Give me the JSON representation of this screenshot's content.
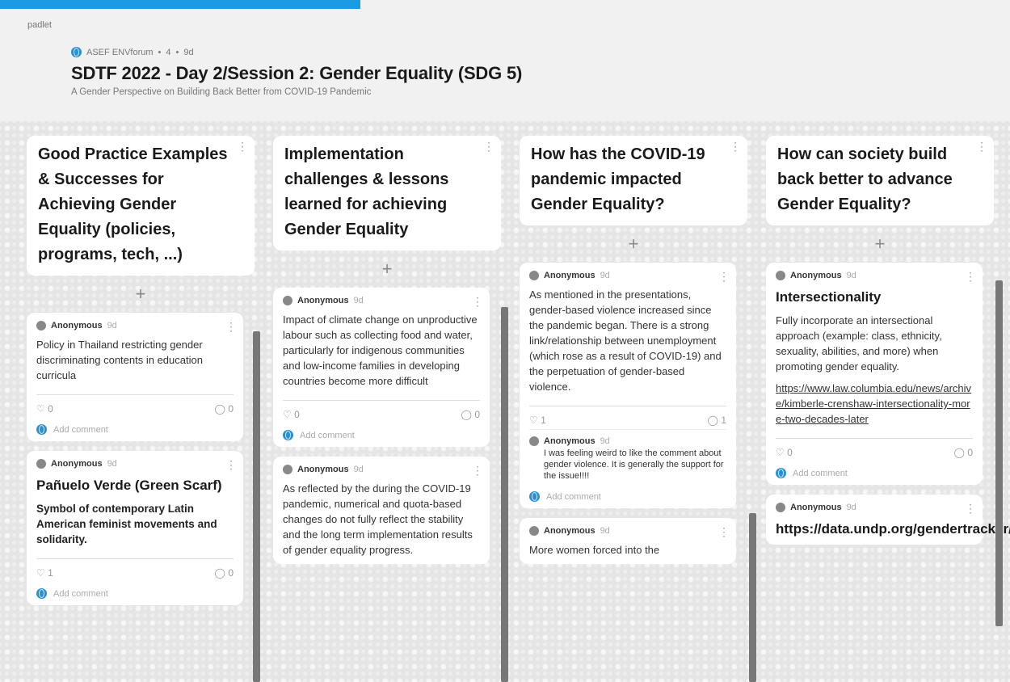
{
  "brand": "padlet",
  "header": {
    "org": "ASEF ENVforum",
    "likes": "4",
    "age": "9d",
    "title": "SDTF 2022 - Day 2/Session 2: Gender Equality (SDG 5)",
    "subtitle": "A Gender Perspective on Building Back Better from COVID-19 Pandemic"
  },
  "ui": {
    "add": "+",
    "menu": "⋮",
    "add_comment": "Add comment",
    "dot": "•"
  },
  "columns": [
    {
      "title": "Good Practice Examples & Successes for Achieving Gender Equality (policies, programs, tech, ...)",
      "posts": [
        {
          "author": "Anonymous",
          "time": "9d",
          "body": "Policy in Thailand restricting gender discriminating contents in education curricula",
          "likes": "0",
          "comments": "0"
        },
        {
          "author": "Anonymous",
          "time": "9d",
          "title": "Pañuelo Verde (Green Scarf)",
          "body": "Symbol of contemporary Latin American feminist movements and solidarity.",
          "likes": "1",
          "comments": "0"
        }
      ]
    },
    {
      "title": "Implementation challenges & lessons learned for achieving Gender Equality",
      "posts": [
        {
          "author": "Anonymous",
          "time": "9d",
          "body": "Impact of climate change on unproductive labour such as collecting food and water, particularly for indigenous communities and low-income families in developing countries become more difficult",
          "likes": "0",
          "comments": "0"
        },
        {
          "author": "Anonymous",
          "time": "9d",
          "body": "As reflected by the during the COVID-19 pandemic, numerical and quota-based changes do not fully reflect the stability and the long term implementation results of gender equality progress."
        }
      ]
    },
    {
      "title": "How has the COVID-19 pandemic impacted Gender Equality?",
      "posts": [
        {
          "author": "Anonymous",
          "time": "9d",
          "body": "As mentioned in the presentations, gender-based violence increased since the pandemic began. There is a strong link/relationship between unemployment (which rose as a result of COVID-19) and the perpetuation of gender-based violence.",
          "likes": "1",
          "comments": "1",
          "reply": {
            "author": "Anonymous",
            "time": "9d",
            "body": "I was feeling weird to like the comment about gender violence. It is generally the support for the issue!!!!"
          }
        },
        {
          "author": "Anonymous",
          "time": "9d",
          "body": "More women forced into the"
        }
      ]
    },
    {
      "title": "How can society build back better to advance Gender Equality?",
      "posts": [
        {
          "author": "Anonymous",
          "time": "9d",
          "title": "Intersectionality",
          "body": "Fully incorporate an intersectional approach (example: class, ethnicity, sexuality, abilities, and more) when promoting gender equality.",
          "link": "https://www.law.columbia.edu/news/archive/kimberle-crenshaw-intersectionality-more-two-decades-later",
          "likes": "0",
          "comments": "0"
        },
        {
          "author": "Anonymous",
          "time": "9d",
          "title": "https://data.undp.org/gendertracker/"
        }
      ]
    }
  ]
}
